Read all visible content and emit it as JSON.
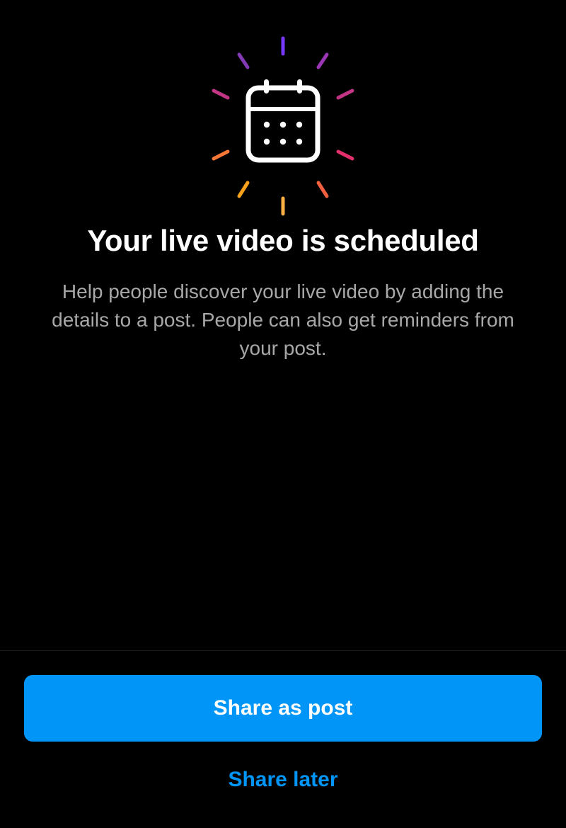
{
  "icon": "calendar-sparkle-icon",
  "title": "Your live video is scheduled",
  "subtitle": "Help people discover your live video by adding the details to a post. People can also get reminders from your post.",
  "buttons": {
    "primary": "Share as post",
    "secondary": "Share later"
  },
  "colors": {
    "primary": "#0095f6",
    "background": "#000000",
    "text_muted": "#a8a8a8"
  }
}
